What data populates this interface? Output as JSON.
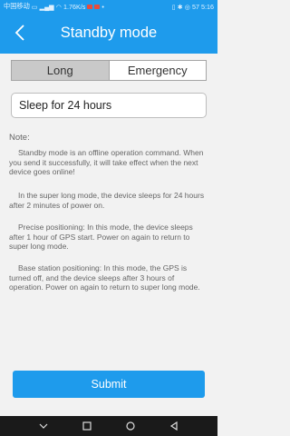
{
  "status_bar": {
    "carrier": "中国移动",
    "speed": "1.76K/s",
    "battery": "57",
    "time": "5:16"
  },
  "header": {
    "title": "Standby mode"
  },
  "mode_tabs": [
    {
      "label": "Long",
      "active": true
    },
    {
      "label": "Emergency",
      "active": false
    }
  ],
  "sleep_select": {
    "value": "Sleep for 24 hours"
  },
  "note": {
    "title": "Note:",
    "paragraphs": [
      "Standby mode is an offline operation command. When you send it successfully, it will take effect when the next device goes online!",
      "In the super long mode, the device sleeps for 24 hours after 2 minutes of power on.",
      "Precise positioning: In this mode, the device sleeps after 1 hour of GPS start. Power on again to return to super long mode.",
      "Base station positioning: In this mode, the GPS is turned off, and the device sleeps after 3 hours of operation. Power on again to return to super long mode."
    ]
  },
  "submit": {
    "label": "Submit"
  },
  "colors": {
    "primary": "#1e9bec",
    "active_tab": "#c9c9c9",
    "background": "#f2f2f2"
  }
}
